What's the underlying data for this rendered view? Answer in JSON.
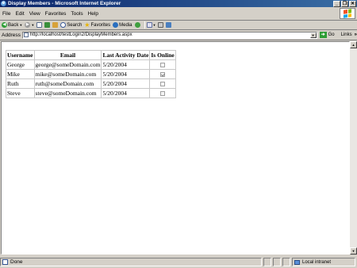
{
  "window": {
    "title": "Display Members - Microsoft Internet Explorer",
    "buttons": [
      "_",
      "❐",
      "✕"
    ]
  },
  "menu": [
    "File",
    "Edit",
    "View",
    "Favorites",
    "Tools",
    "Help"
  ],
  "toolbar": {
    "back": "Back",
    "search": "Search",
    "favorites": "Favorites",
    "media": "Media"
  },
  "address": {
    "label": "Address",
    "url": "http://localhost/testLogin2/DisplayMembers.aspx",
    "go": "Go",
    "links": "Links"
  },
  "table": {
    "headers": [
      "Username",
      "Email",
      "Last Activity Date",
      "Is Online"
    ],
    "rows": [
      {
        "username": "George",
        "email": "george@someDomain.com",
        "last_activity": "5/20/2004",
        "online": false
      },
      {
        "username": "Mike",
        "email": "mike@someDomain.com",
        "last_activity": "5/20/2004",
        "online": true
      },
      {
        "username": "Ruth",
        "email": "ruth@someDomain.com",
        "last_activity": "5/20/2004",
        "online": false
      },
      {
        "username": "Steve",
        "email": "steve@someDomain.com",
        "last_activity": "5/20/2004",
        "online": false
      }
    ]
  },
  "status": {
    "text": "Done",
    "zone": "Local intranet"
  }
}
